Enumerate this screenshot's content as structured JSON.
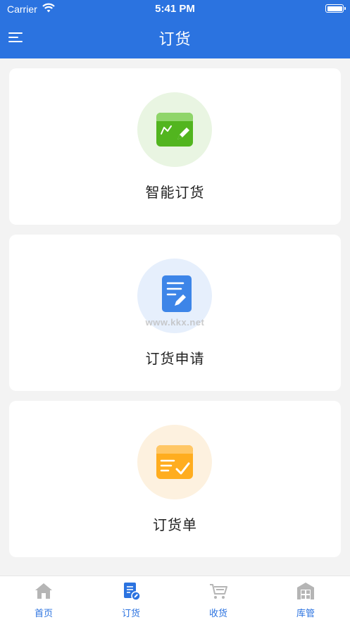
{
  "status_bar": {
    "carrier": "Carrier",
    "time": "5:41 PM"
  },
  "header": {
    "title": "订货",
    "menu_icon": "menu-icon"
  },
  "cards": [
    {
      "label": "智能订货",
      "icon": "smart-order-icon",
      "icon_color": "#52b51f",
      "bg_color": "#e9f5e2"
    },
    {
      "label": "订货申请",
      "icon": "order-request-icon",
      "icon_color": "#3d85e8",
      "bg_color": "#e6effc"
    },
    {
      "label": "订货单",
      "icon": "order-list-icon",
      "icon_color": "#ffad1f",
      "bg_color": "#fdf1df"
    }
  ],
  "watermark": "www.kkx.net",
  "tabs": [
    {
      "label": "首页",
      "icon": "home-icon",
      "active": false
    },
    {
      "label": "订货",
      "icon": "order-icon",
      "active": true
    },
    {
      "label": "收货",
      "icon": "cart-icon",
      "active": false
    },
    {
      "label": "库管",
      "icon": "warehouse-icon",
      "active": false
    }
  ],
  "colors": {
    "primary": "#2b73e0",
    "inactive_icon": "#b5b5b5"
  }
}
